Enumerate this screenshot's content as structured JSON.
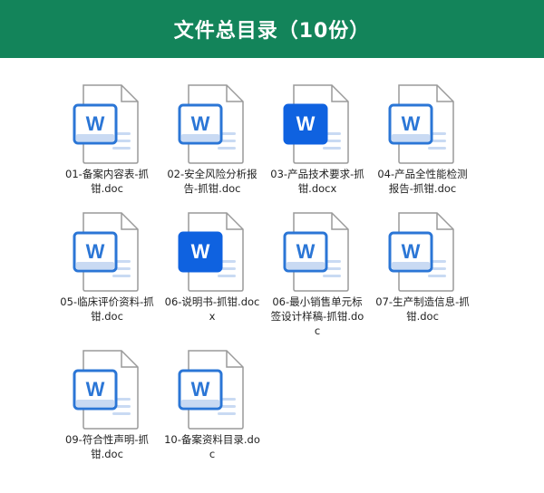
{
  "header": {
    "title": "文件总目录（10份）"
  },
  "colors": {
    "header_bg": "#13845a",
    "doc_badge": "#2b76d6",
    "docx_badge": "#0f62e0",
    "page_stroke": "#9a9a9a",
    "page_lines": "#c9daf3"
  },
  "files": [
    {
      "name": "01-备案内容表-抓钳.doc",
      "type": "doc",
      "icon": "word-doc-icon"
    },
    {
      "name": "02-安全风险分析报告-抓钳.doc",
      "type": "doc",
      "icon": "word-doc-icon"
    },
    {
      "name": "03-产品技术要求-抓钳.docx",
      "type": "docx",
      "icon": "word-docx-icon"
    },
    {
      "name": "04-产品全性能检测报告-抓钳.doc",
      "type": "doc",
      "icon": "word-doc-icon"
    },
    {
      "name": "05-临床评价资料-抓钳.doc",
      "type": "doc",
      "icon": "word-doc-icon"
    },
    {
      "name": "06-说明书-抓钳.docx",
      "type": "docx",
      "icon": "word-docx-icon"
    },
    {
      "name": "06-最小销售单元标签设计样稿-抓钳.doc",
      "type": "doc",
      "icon": "word-doc-icon"
    },
    {
      "name": "07-生产制造信息-抓钳.doc",
      "type": "doc",
      "icon": "word-doc-icon"
    },
    {
      "name": "09-符合性声明-抓钳.doc",
      "type": "doc",
      "icon": "word-doc-icon"
    },
    {
      "name": "10-备案资料目录.doc",
      "type": "doc",
      "icon": "word-doc-icon"
    }
  ]
}
